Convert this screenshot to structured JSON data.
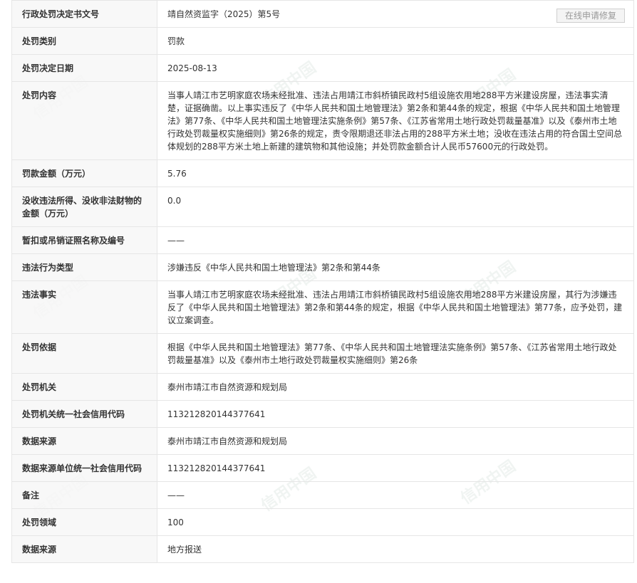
{
  "repair_button_label": "在线申请修复",
  "rows": [
    {
      "label": "行政处罚决定书文号",
      "value": "靖自然资监字（2025）第5号"
    },
    {
      "label": "处罚类别",
      "value": "罚款"
    },
    {
      "label": "处罚决定日期",
      "value": "2025-08-13"
    },
    {
      "label": "处罚内容",
      "value": "当事人靖江市艺明家庭农场未经批准、违法占用靖江市斜桥镇民政村5组设施农用地288平方米建设房屋，违法事实清楚，证据确凿。以上事实违反了《中华人民共和国土地管理法》第2条和第44条的规定，根据《中华人民共和国土地管理法》第77条、《中华人民共和国土地管理法实施条例》第57条、《江苏省常用土地行政处罚裁量基准》以及《泰州市土地行政处罚裁量权实施细则》第26条的规定，责令限期退还非法占用的288平方米土地；没收在违法占用的符合国土空间总体规划的288平方米土地上新建的建筑物和其他设施；并处罚款金额合计人民币57600元的行政处罚。"
    },
    {
      "label": "罚款金额（万元）",
      "value": "5.76"
    },
    {
      "label": "没收违法所得、没收非法财物的金额（万元）",
      "value": "0.0"
    },
    {
      "label": "暂扣或吊销证照名称及编号",
      "value": "——"
    },
    {
      "label": "违法行为类型",
      "value": "涉嫌违反《中华人民共和国土地管理法》第2条和第44条"
    },
    {
      "label": "违法事实",
      "value": "当事人靖江市艺明家庭农场未经批准、违法占用靖江市斜桥镇民政村5组设施农用地288平方米建设房屋，其行为涉嫌违反了《中华人民共和国土地管理法》第2条和第44条的规定，根据《中华人民共和国土地管理法》第77条，应予处罚，建议立案调查。"
    },
    {
      "label": "处罚依据",
      "value": "根据《中华人民共和国土地管理法》第77条、《中华人民共和国土地管理法实施条例》第57条、《江苏省常用土地行政处罚裁量基准》以及《泰州市土地行政处罚裁量权实施细则》第26条"
    },
    {
      "label": "处罚机关",
      "value": "泰州市靖江市自然资源和规划局"
    },
    {
      "label": "处罚机关统一社会信用代码",
      "value": "113212820144377641"
    },
    {
      "label": "数据来源",
      "value": "泰州市靖江市自然资源和规划局"
    },
    {
      "label": "数据来源单位统一社会信用代码",
      "value": "113212820144377641"
    },
    {
      "label": "备注",
      "value": "——"
    },
    {
      "label": "处罚领域",
      "value": "100"
    },
    {
      "label": "数据来源",
      "value": "地方报送"
    }
  ],
  "watermark_text": "信用中国"
}
